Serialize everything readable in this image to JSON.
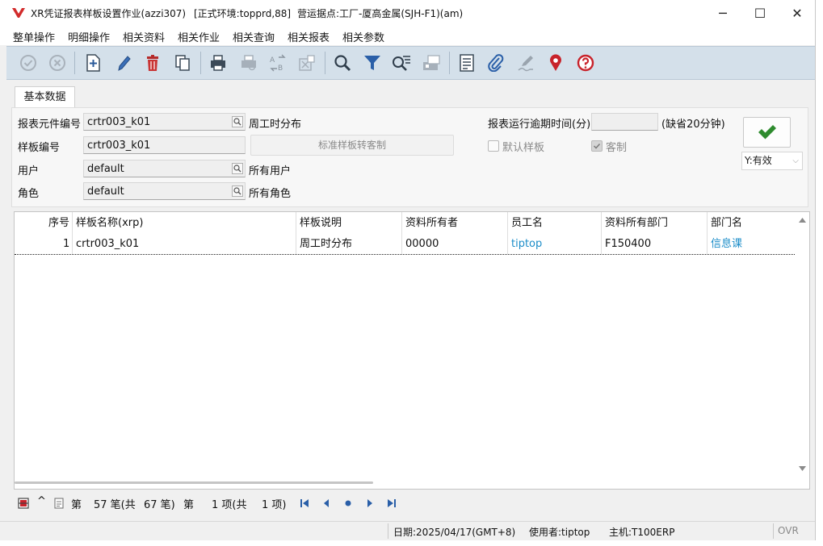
{
  "window": {
    "title": "XR凭证报表样板设置作业(azzi307)",
    "env": "[正式环境:topprd,88]",
    "site": "营运据点:工厂-厦高金属(SJH-F1)(am)",
    "minimize_glyph": "─",
    "maximize_glyph": "☐",
    "close_glyph": "✕"
  },
  "menu": [
    "整单操作",
    "明细操作",
    "相关资料",
    "相关作业",
    "相关查询",
    "相关报表",
    "相关参数"
  ],
  "toolbar": {
    "icons": [
      "confirm-icon",
      "cancel-icon",
      "add-icon",
      "edit-icon",
      "delete-icon",
      "copy-icon",
      "print-icon",
      "print-preview-icon",
      "convert-icon",
      "export-icon",
      "search-icon",
      "filter-icon",
      "advanced-query-icon",
      "data-icon",
      "list-icon",
      "attachment-icon",
      "signature-icon",
      "location-icon",
      "help-icon"
    ]
  },
  "tab": {
    "label": "基本数据"
  },
  "form": {
    "element_code_label": "报表元件编号",
    "element_code_value": "crtr003_k01",
    "element_code_desc": "周工时分布",
    "template_code_label": "样板编号",
    "template_code_value": "crtr003_k01",
    "convert_button": "标准样板转客制",
    "user_label": "用户",
    "user_value": "default",
    "user_desc": "所有用户",
    "role_label": "角色",
    "role_value": "default",
    "role_desc": "所有角色",
    "timeout_label": "报表运行逾期时间(分)",
    "timeout_value": "",
    "timeout_hint": "(缺省20分钟)",
    "default_template_label": "默认样板",
    "default_template_checked": false,
    "custom_label": "客制",
    "custom_checked": true,
    "status_value": "Y:有效",
    "status_chevron": "⌵"
  },
  "grid": {
    "headers": [
      "序号",
      "样板名称(xrp)",
      "样板说明",
      "资料所有者",
      "员工名",
      "资料所有部门",
      "部门名"
    ],
    "rows": [
      [
        "1",
        "crtr003_k01",
        "周工时分布",
        "00000",
        "tiptop",
        "F150400",
        "信息课"
      ]
    ]
  },
  "pager": {
    "caret": "^",
    "text_di": "第",
    "record_current": "57 笔(共",
    "record_total": "67 笔)",
    "text_di2": "第",
    "item_current": "1 项(共",
    "item_total": "1 项)"
  },
  "statusbar": {
    "date": "日期:2025/04/17(GMT+8)",
    "user": "使用者:tiptop",
    "host": "主机:T100ERP",
    "mode": "OVR"
  },
  "colors": {
    "toolbar_bg": "#d4e0ea",
    "link": "#1a8cc8",
    "ok_green": "#2e8b2e",
    "brand_red": "#d22b2b"
  }
}
